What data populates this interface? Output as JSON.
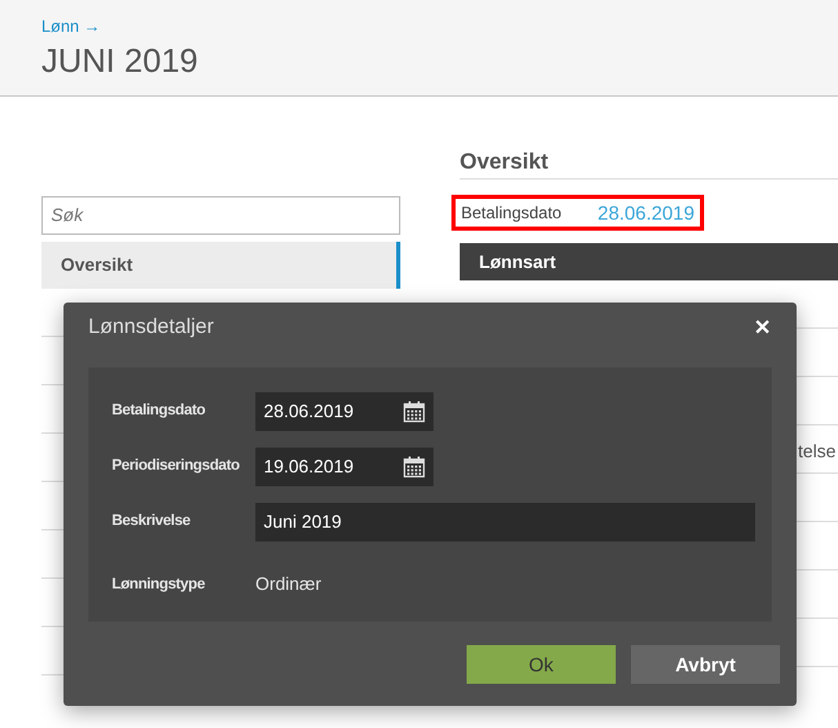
{
  "header": {
    "breadcrumb": "Lønn →",
    "title": "JUNI 2019"
  },
  "sidebar": {
    "search": {
      "placeholder": "Søk"
    },
    "items": [
      {
        "label": "Oversikt",
        "selected": true
      }
    ]
  },
  "overview": {
    "heading": "Oversikt",
    "payment_label": "Betalingsdato",
    "payment_date": "28.06.2019",
    "table": {
      "columns": [
        "Lønnsart"
      ],
      "visible_fragment": "telse"
    }
  },
  "dialog": {
    "title": "Lønnsdetaljer",
    "close": "✕",
    "fields": [
      {
        "kind": "date",
        "label": "Betalingsdato",
        "value": "28.06.2019"
      },
      {
        "kind": "date",
        "label": "Periodiseringsdato",
        "value": "19.06.2019"
      },
      {
        "kind": "text",
        "label": "Beskrivelse",
        "value": "Juni 2019"
      },
      {
        "kind": "static",
        "label": "Lønningstype",
        "value": "Ordinær"
      }
    ],
    "buttons": [
      {
        "label": "Ok",
        "kind": "primary"
      },
      {
        "label": "Avbryt",
        "kind": "secondary"
      }
    ]
  }
}
